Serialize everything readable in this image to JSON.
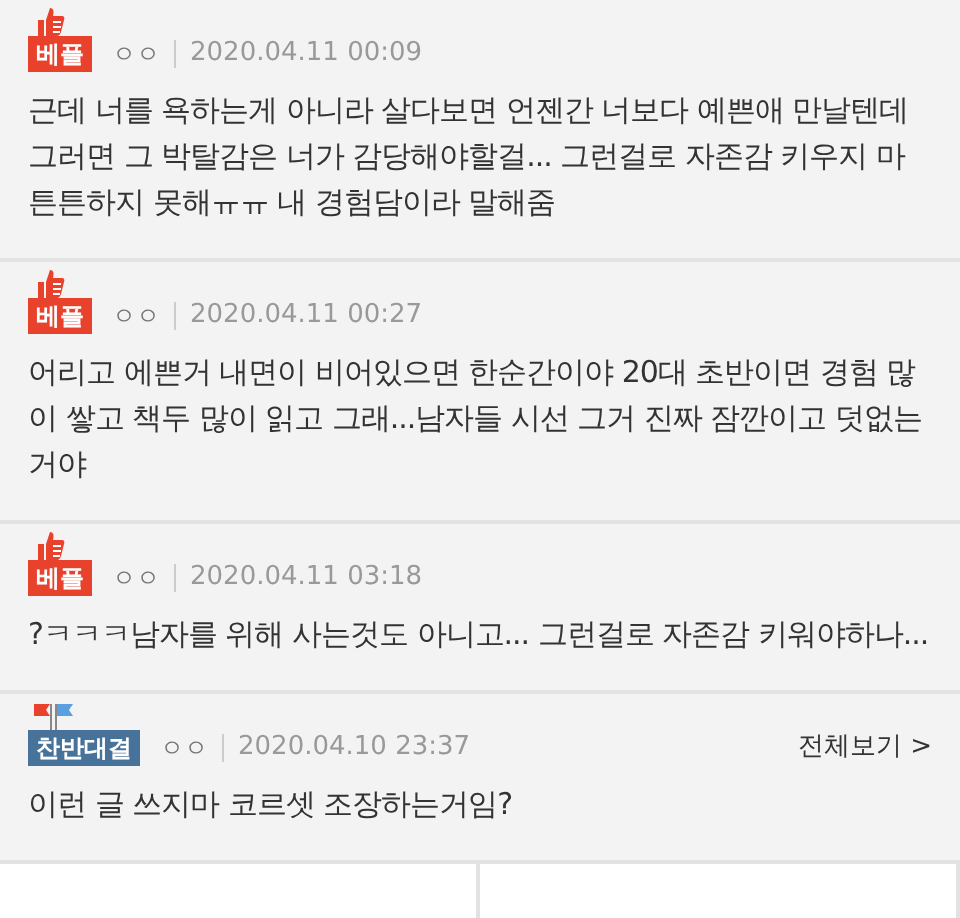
{
  "comments": [
    {
      "badge": {
        "kind": "best",
        "label": "베플"
      },
      "author": "ㅇㅇ",
      "date": "2020.04.11 00:09",
      "text": "근데 너를 욕하는게 아니라 살다보면 언젠간 너보다 예쁜애 만날텐데 그러면 그 박탈감은 너가 감당해야할걸... 그런걸로 자존감 키우지 마 튼튼하지 못해ㅠㅠ 내 경험담이라 말해줌"
    },
    {
      "badge": {
        "kind": "best",
        "label": "베플"
      },
      "author": "ㅇㅇ",
      "date": "2020.04.11 00:27",
      "text": "어리고 에쁜거 내면이 비어있으면 한순간이야 20대 초반이면 경험 많이 쌓고 책두 많이 읽고 그래...남자들 시선 그거 진짜 잠깐이고 덧없는거야"
    },
    {
      "badge": {
        "kind": "best",
        "label": "베플"
      },
      "author": "ㅇㅇ",
      "date": "2020.04.11 03:18",
      "text": "?ㅋㅋㅋ남자를 위해 사는것도 아니고... 그런걸로 자존감 키워야하나..."
    },
    {
      "badge": {
        "kind": "versus",
        "label": "찬반대결"
      },
      "author": "ㅇㅇ",
      "date": "2020.04.10 23:37",
      "text": "이런 글 쓰지마 코르셋 조장하는거임?",
      "more": "전체보기 >"
    }
  ]
}
